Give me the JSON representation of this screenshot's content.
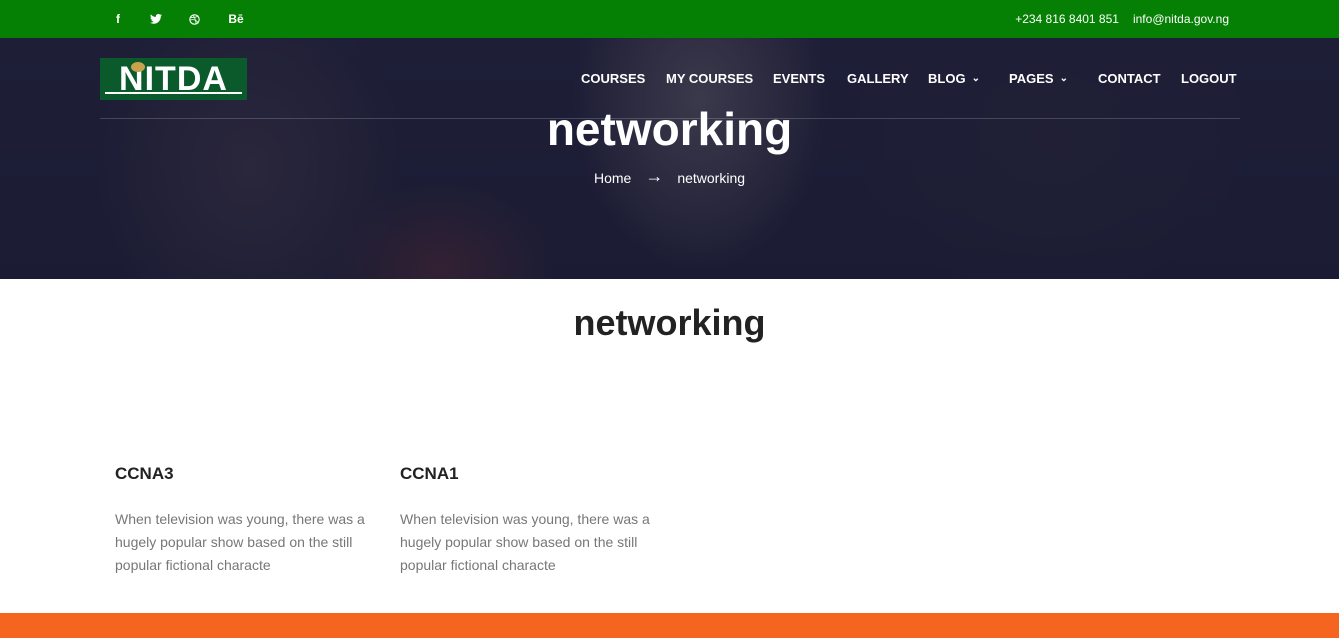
{
  "topbar": {
    "social": [
      {
        "name": "facebook",
        "glyph": "f"
      },
      {
        "name": "twitter",
        "glyph": "🐦"
      },
      {
        "name": "dribbble",
        "glyph": "⊛"
      },
      {
        "name": "behance",
        "glyph": "Bē"
      }
    ],
    "phone": "+234 816 8401 851",
    "email": "info@nitda.gov.ng",
    "bg_color": "#058004"
  },
  "logo": {
    "text": "NITDA"
  },
  "nav": {
    "courses": "COURSES",
    "my_courses": "MY COURSES",
    "events": "EVENTS",
    "gallery": "GALLERY",
    "blog": "BLOG",
    "pages": "PAGES",
    "contact": "CONTACT",
    "logout": "LOGOUT"
  },
  "hero": {
    "title": "networking",
    "breadcrumb_home": "Home",
    "breadcrumb_current": "networking"
  },
  "page_title": "networking",
  "courses": [
    {
      "title": "CCNA3",
      "description": "When television was young, there was a hugely popular show based on the still popular fictional characte"
    },
    {
      "title": "CCNA1",
      "description": "When television was young, there was a hugely popular show based on the still popular fictional characte"
    }
  ],
  "colors": {
    "accent_orange": "#f66520",
    "brand_green": "#058004"
  }
}
